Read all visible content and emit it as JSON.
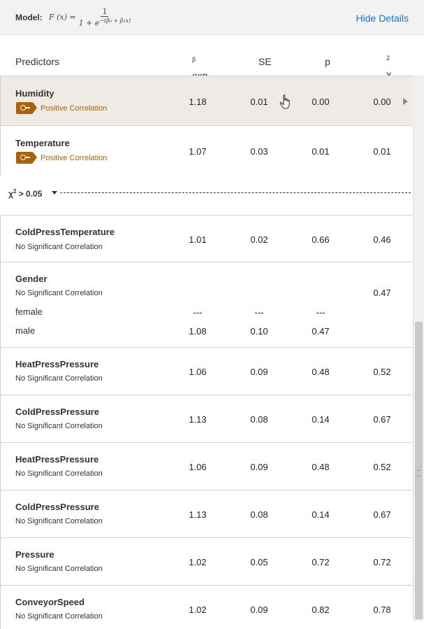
{
  "header": {
    "model_label": "Model:",
    "formula_lhs": "F (x) =",
    "formula_num": "1",
    "formula_den": "1 + e",
    "formula_exp": "−(β₀ + β₁x)",
    "hide_label": "Hide Details"
  },
  "columns": {
    "predictors": "Predictors",
    "exp": "exp",
    "exp_sup": "β",
    "se": "SE",
    "p": "p",
    "chi": "χ",
    "chi_sup": "2"
  },
  "rows": [
    {
      "name": "Humidity",
      "label": "Positive Correlation",
      "exp": "1.18",
      "se": "0.01",
      "p": "0.00",
      "chi": "0.00"
    },
    {
      "name": "Temperature",
      "label": "Positive Correlation",
      "exp": "1.07",
      "se": "0.03",
      "p": "0.01",
      "chi": "0.01"
    },
    {
      "name": "ColdPressTemperature",
      "label": "No Significant Correlation",
      "exp": "1.01",
      "se": "0.02",
      "p": "0.66",
      "chi": "0.46"
    },
    {
      "name": "Gender",
      "label": "No Significant Correlation",
      "chi": "0.47",
      "levels": [
        {
          "name": "female",
          "exp": "---",
          "se": "---",
          "p": "---"
        },
        {
          "name": "male",
          "exp": "1.08",
          "se": "0.10",
          "p": "0.47"
        }
      ]
    },
    {
      "name": "HeatPressPressure",
      "label": "No Significant Correlation",
      "exp": "1.06",
      "se": "0.09",
      "p": "0.48",
      "chi": "0.52"
    },
    {
      "name": "ColdPressPressure",
      "label": "No Significant Correlation",
      "exp": "1.13",
      "se": "0.08",
      "p": "0.14",
      "chi": "0.67"
    },
    {
      "name": "HeatPressPressure",
      "label": "No Significant Correlation",
      "exp": "1.06",
      "se": "0.09",
      "p": "0.48",
      "chi": "0.52"
    },
    {
      "name": "ColdPressPressure",
      "label": "No Significant Correlation",
      "exp": "1.13",
      "se": "0.08",
      "p": "0.14",
      "chi": "0.67"
    },
    {
      "name": "Pressure",
      "label": "No Significant Correlation",
      "exp": "1.02",
      "se": "0.05",
      "p": "0.72",
      "chi": "0.72"
    },
    {
      "name": "ConveyorSpeed",
      "label": "No Significant Correlation",
      "exp": "1.02",
      "se": "0.09",
      "p": "0.82",
      "chi": "0.78"
    }
  ],
  "cutoff": {
    "symbol": "χ",
    "sup": "2",
    "text": " > 0.05"
  },
  "colors": {
    "accent": "#a8620a",
    "link": "#1a73c8",
    "selected_row": "#eeeae6"
  },
  "icons": {
    "badge": "key-icon",
    "row_expand": "triangle-right-icon",
    "cutoff_toggle": "triangle-down-icon"
  }
}
